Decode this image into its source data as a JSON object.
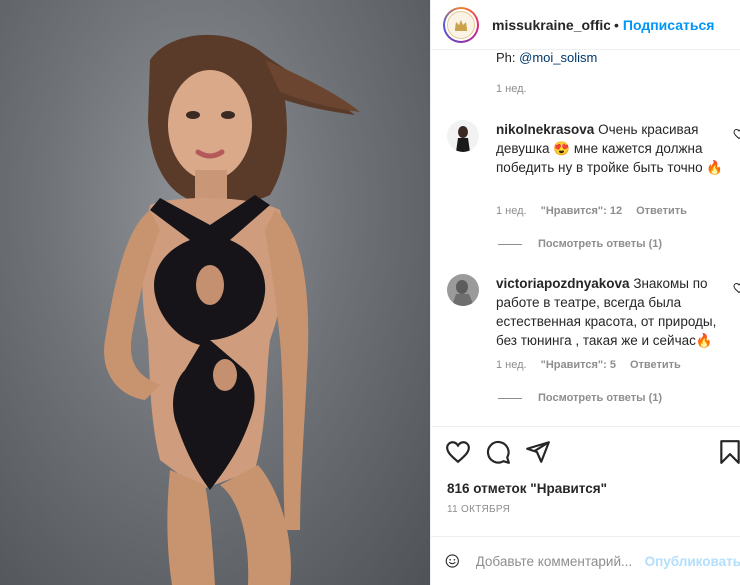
{
  "header": {
    "username": "missukraine_officia",
    "separator": "•",
    "follow_label": "Подписаться"
  },
  "caption": {
    "credit_prefix": "Ph: ",
    "credit_mention": "@moi_solism",
    "time": "1 нед."
  },
  "comments": [
    {
      "username": "nikolnekrasova",
      "text": "Очень красивая девушка 😍 мне кажется должна победить ну в тройке быть точно 🔥",
      "time": "1 нед.",
      "likes": "\"Нравится\": 12",
      "reply": "Ответить",
      "view_replies": "Посмотреть ответы (1)"
    },
    {
      "username": "victoriapozdnyakova",
      "text": "Знакомы по работе в театре, всегда была естественная красота, от природы, без тюнинга , такая же и сейчас🔥",
      "time": "1 нед.",
      "likes": "\"Нравится\": 5",
      "reply": "Ответить",
      "view_replies": "Посмотреть ответы (1)"
    }
  ],
  "post": {
    "likes_text": "816 отметок \"Нравится\"",
    "date": "11 ОКТЯБРЯ"
  },
  "add_comment": {
    "placeholder": "Добавьте комментарий...",
    "publish_label": "Опубликовать"
  },
  "icons": {
    "like": "heart-icon",
    "comment": "comment-icon",
    "share": "share-icon",
    "save": "bookmark-icon",
    "emoji": "emoji-icon"
  },
  "colors": {
    "link": "#0095f6",
    "text": "#262626",
    "muted": "#8e8e8e",
    "publish_disabled": "#b2dffc"
  }
}
